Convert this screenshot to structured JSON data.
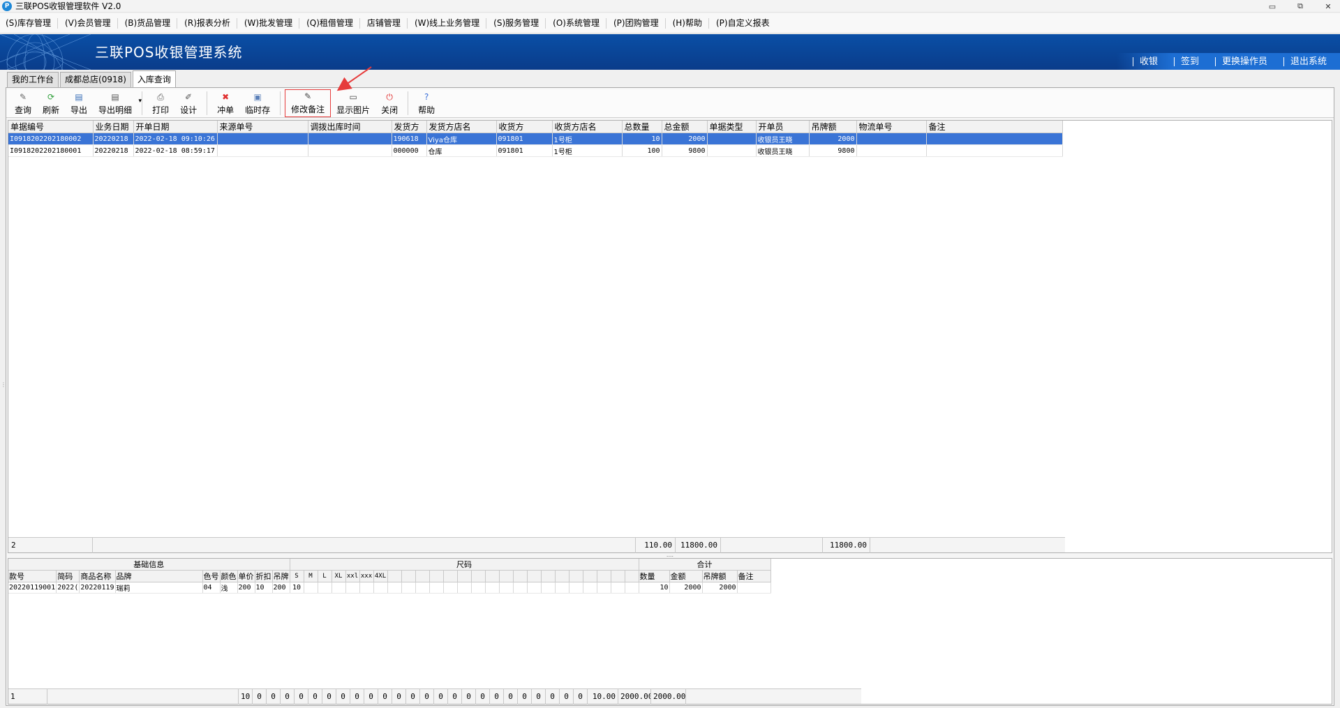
{
  "window": {
    "title": "三联POS收银管理软件 V2.0",
    "app_icon": "P",
    "min": "▭",
    "restore": "⧉",
    "close": "✕"
  },
  "menu": [
    "(S)库存管理",
    "(V)会员管理",
    "(B)货品管理",
    "(R)报表分析",
    "(W)批发管理",
    "(Q)租借管理",
    "店铺管理",
    "(W)线上业务管理",
    "(S)服务管理",
    "(O)系统管理",
    "(P)团购管理",
    "(H)帮助",
    "(P)自定义报表"
  ],
  "banner": {
    "brand": "三联POS收银管理系统",
    "links": [
      "收银",
      "签到",
      "更换操作员",
      "退出系统"
    ]
  },
  "tabs": [
    "我的工作台",
    "成都总店(0918)",
    "入库查询"
  ],
  "toolbar": [
    {
      "label": "查询",
      "icon": "query-icon",
      "glyph": "✎",
      "color": "#666"
    },
    {
      "label": "刷新",
      "icon": "refresh-icon",
      "glyph": "⟳",
      "color": "#2e9e3a"
    },
    {
      "label": "导出",
      "icon": "export-icon",
      "glyph": "▤",
      "color": "#3a6fb8"
    },
    {
      "label": "导出明细",
      "icon": "export-detail-icon",
      "glyph": "▤",
      "color": "#555"
    },
    {
      "label": "打印",
      "icon": "print-icon",
      "glyph": "⎙",
      "color": "#555"
    },
    {
      "label": "设计",
      "icon": "design-icon",
      "glyph": "✐",
      "color": "#555"
    },
    {
      "label": "冲单",
      "icon": "reverse-icon",
      "glyph": "✖",
      "color": "#e03030"
    },
    {
      "label": "临时存",
      "icon": "temp-save-icon",
      "glyph": "▣",
      "color": "#5a7fb8"
    },
    {
      "label": "修改备注",
      "icon": "edit-note-icon",
      "glyph": "✎",
      "color": "#444"
    },
    {
      "label": "显示图片",
      "icon": "show-image-icon",
      "glyph": "▭",
      "color": "#444"
    },
    {
      "label": "关闭",
      "icon": "close-icon",
      "glyph": "⏻",
      "color": "#e03030"
    },
    {
      "label": "帮助",
      "icon": "help-icon",
      "glyph": "?",
      "color": "#3a6fd8"
    }
  ],
  "main_grid": {
    "columns": [
      "单据编号",
      "业务日期",
      "开单日期",
      "来源单号",
      "调拨出库时间",
      "发货方",
      "发货方店名",
      "收货方",
      "收货方店名",
      "总数量",
      "总金额",
      "单据类型",
      "开单员",
      "吊牌额",
      "物流单号",
      "备注"
    ],
    "rows": [
      [
        "I0918202202180002",
        "20220218",
        "2022-02-18 09:10:26",
        "",
        "",
        "190618",
        "Viya仓库",
        "091801",
        "1号柜",
        "10",
        "2000",
        "",
        "收银员王晓",
        "2000",
        "",
        ""
      ],
      [
        "I0918202202180001",
        "20220218",
        "2022-02-18 08:59:17",
        "",
        "",
        "000000",
        "仓库",
        "091801",
        "1号柜",
        "100",
        "9800",
        "",
        "收银员王晓",
        "9800",
        "",
        ""
      ]
    ],
    "footer": {
      "count": "2",
      "total_qty": "110.00",
      "total_amount": "11800.00",
      "total_tag": "11800.00"
    }
  },
  "detail_grid": {
    "groups": [
      "基础信息",
      "尺码",
      "合计"
    ],
    "base_columns": [
      "款号",
      "简码",
      "商品名称",
      "品牌",
      "色号",
      "颜色",
      "单价",
      "折扣",
      "吊牌"
    ],
    "size_columns": [
      "S",
      "M",
      "L",
      "XL",
      "xxl",
      "xxx",
      "4XL",
      "",
      "",
      "",
      "",
      "",
      "",
      "",
      "",
      "",
      "",
      "",
      "",
      "",
      "",
      "",
      "",
      "",
      ""
    ],
    "total_columns": [
      "数量",
      "金额",
      "吊牌额",
      "备注"
    ],
    "rows": [
      {
        "base": [
          "20220119001",
          "2022(",
          "20220119",
          "瑞莉",
          "04",
          "浅",
          "200",
          "10",
          "200"
        ],
        "sizes": [
          "10",
          "",
          "",
          "",
          "",
          "",
          "",
          "",
          "",
          "",
          "",
          "",
          "",
          "",
          "",
          "",
          "",
          "",
          "",
          "",
          "",
          "",
          "",
          "",
          ""
        ],
        "totals": [
          "10",
          "2000",
          "2000",
          ""
        ]
      }
    ],
    "footer": {
      "count": "1",
      "first": "10",
      "sizes": [
        "0",
        "0",
        "0",
        "0",
        "0",
        "0",
        "0",
        "0",
        "0",
        "0",
        "0",
        "0",
        "0",
        "0",
        "0",
        "0",
        "0",
        "0",
        "0",
        "0",
        "0",
        "0",
        "0",
        "0"
      ],
      "qty": "10.00",
      "amount": "2000.00",
      "tag": "2000.00"
    }
  }
}
